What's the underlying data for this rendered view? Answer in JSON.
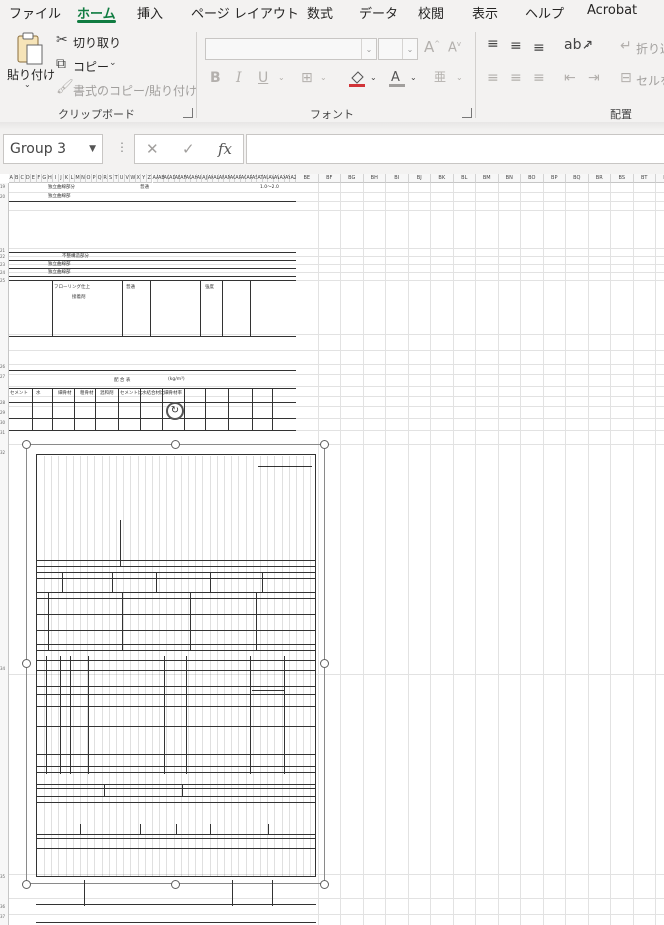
{
  "menu": {
    "tabs": [
      {
        "label": "ファイル",
        "active": false
      },
      {
        "label": "ホーム",
        "active": true
      },
      {
        "label": "挿入",
        "active": false
      },
      {
        "label": "ページ レイアウト",
        "active": false
      },
      {
        "label": "数式",
        "active": false
      },
      {
        "label": "データ",
        "active": false
      },
      {
        "label": "校閲",
        "active": false
      },
      {
        "label": "表示",
        "active": false
      },
      {
        "label": "ヘルプ",
        "active": false
      },
      {
        "label": "Acrobat",
        "active": false
      }
    ]
  },
  "ribbon": {
    "clipboard": {
      "paste": "貼り付け",
      "cut": "切り取り",
      "copy": "コピー",
      "format_painter": "書式のコピー/貼り付け",
      "group_label": "クリップボード"
    },
    "font": {
      "font_name": "",
      "font_size": "",
      "bold": "B",
      "italic": "I",
      "underline": "U",
      "group_label": "フォント"
    },
    "alignment": {
      "wrap_text": "折り返",
      "merge": "セルを",
      "group_label": "配置"
    }
  },
  "formula_bar": {
    "name_box": "Group 3",
    "cancel": "✕",
    "enter": "✓",
    "fx": "fx",
    "value": ""
  },
  "sheet": {
    "columns": [
      "A",
      "B",
      "C",
      "D",
      "E",
      "F",
      "G",
      "H",
      "I",
      "J",
      "K",
      "L",
      "M",
      "N",
      "O",
      "P",
      "Q",
      "R",
      "S",
      "T",
      "U",
      "V",
      "W",
      "X",
      "Y",
      "Z",
      "AA",
      "AB",
      "AC",
      "AD",
      "AE",
      "AF",
      "AG",
      "AH",
      "AI",
      "AJ",
      "AK",
      "AL",
      "AM",
      "AN",
      "AO",
      "AP",
      "AQ",
      "AR",
      "AS",
      "AT",
      "AU",
      "AV",
      "AW",
      "AX",
      "AY",
      "AZ",
      "BA",
      "BB",
      "BC",
      "BD",
      "BE",
      "BF",
      "BG",
      "BH",
      "BI",
      "BJ",
      "BK",
      "BL",
      "BM",
      "BN",
      "BO",
      "BP",
      "BQ",
      "BR",
      "BS",
      "BT",
      "BU"
    ],
    "right_columns": [
      "BE",
      "BF",
      "BG",
      "BH",
      "BI",
      "BJ",
      "BK",
      "BL",
      "BM",
      "BN",
      "BO",
      "BP",
      "BQ",
      "BR",
      "BS",
      "BT",
      "BU"
    ],
    "form_texts": [
      "独立曲線部分",
      "独立曲線部",
      "普通",
      "1.0〜2.0",
      "不整構造部分",
      "独立曲線部",
      "独立曲線部",
      "フローリング仕上",
      "接着剤",
      "普通",
      "強度",
      "配 合 表",
      "(kg/m³)",
      "セメント",
      "水",
      "細骨材",
      "粗骨材",
      "混和剤",
      "セメント比",
      "水結合材比",
      "細骨材率"
    ]
  }
}
